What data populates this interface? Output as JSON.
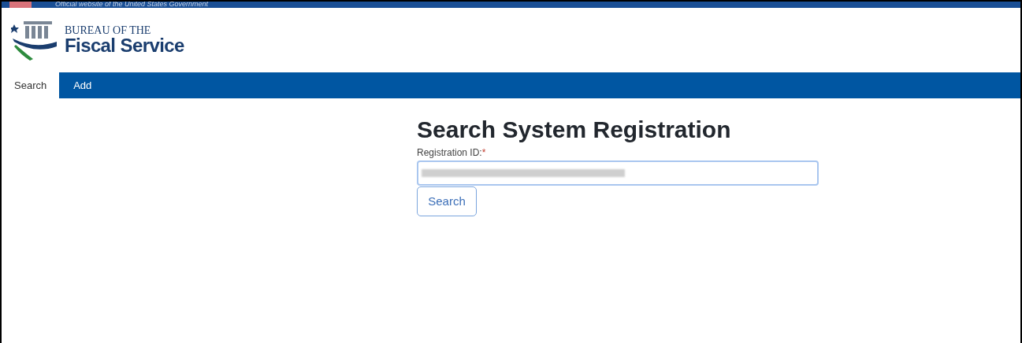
{
  "banner": {
    "text": "Official website of the United States Government"
  },
  "logo": {
    "line1": "BUREAU OF THE",
    "line2": "Fiscal Service"
  },
  "tabs": [
    {
      "label": "Search",
      "selected": true
    },
    {
      "label": "Add",
      "selected": false
    }
  ],
  "form": {
    "title": "Search System Registration",
    "label": "Registration ID:",
    "required_mark": "*",
    "button": "Search"
  }
}
